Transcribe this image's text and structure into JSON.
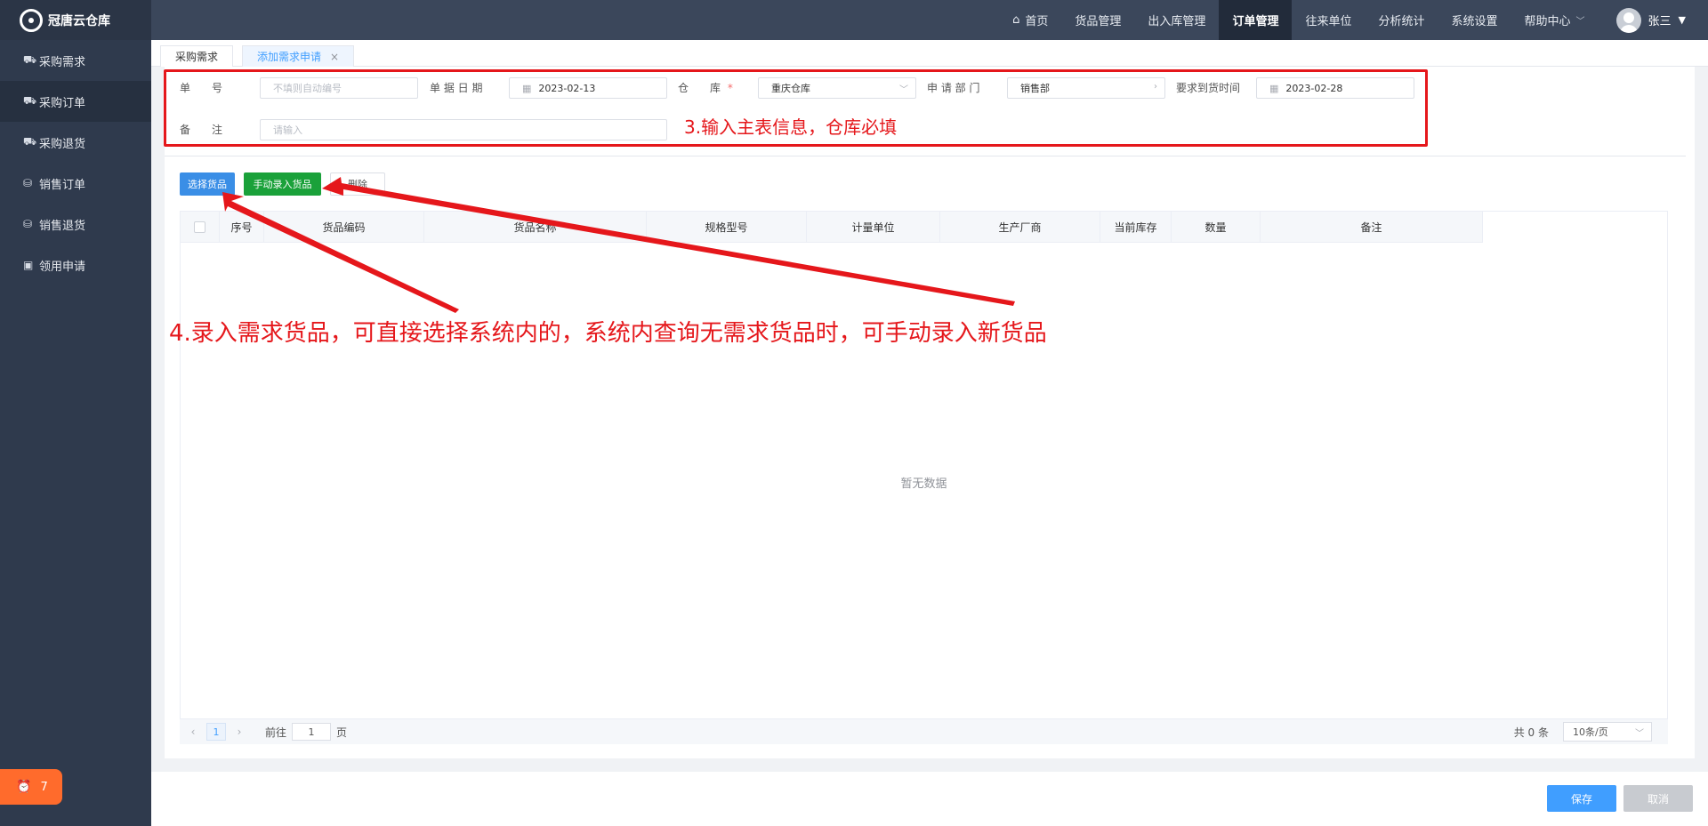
{
  "app": {
    "title": "冠唐云仓库"
  },
  "sidebar": {
    "items": [
      {
        "label": "采购需求",
        "icon": "cart-icon",
        "active": false
      },
      {
        "label": "采购订单",
        "icon": "cart-icon",
        "active": true
      },
      {
        "label": "采购退货",
        "icon": "cart-icon",
        "active": false
      },
      {
        "label": "销售订单",
        "icon": "bag-icon",
        "active": false
      },
      {
        "label": "销售退货",
        "icon": "bag-icon",
        "active": false
      },
      {
        "label": "领用申请",
        "icon": "briefcase-icon",
        "active": false
      }
    ],
    "notification_count": "7"
  },
  "topnav": {
    "items": [
      {
        "label": "首页",
        "icon": "home-icon"
      },
      {
        "label": "货品管理"
      },
      {
        "label": "出入库管理"
      },
      {
        "label": "订单管理",
        "active": true
      },
      {
        "label": "往来单位"
      },
      {
        "label": "分析统计"
      },
      {
        "label": "系统设置"
      },
      {
        "label": "帮助中心",
        "has_caret": true
      }
    ],
    "user": "张三"
  },
  "tabs": [
    {
      "label": "采购需求"
    },
    {
      "label": "添加需求申请",
      "active": true,
      "closable": true
    }
  ],
  "form": {
    "order_no": {
      "label": "单　　号",
      "placeholder": "不填则自动编号"
    },
    "order_date": {
      "label": "单 据 日 期",
      "value": "2023-02-13"
    },
    "warehouse": {
      "label": "仓　　库",
      "required_mark": "*",
      "value": "重庆仓库"
    },
    "department": {
      "label": "申 请 部 门",
      "value": "销售部"
    },
    "due_date": {
      "label": "要求到货时间",
      "value": "2023-02-28"
    },
    "remark": {
      "label": "备　　注",
      "placeholder": "请输入"
    }
  },
  "annotations": {
    "step3": "3.输入主表信息，仓库必填",
    "step4": "4.录入需求货品，可直接选择系统内的，系统内查询无需求货品时，可手动录入新货品"
  },
  "actions": {
    "select_goods": "选择货品",
    "manual_entry": "手动录入货品",
    "delete": "删除"
  },
  "table": {
    "columns": [
      "序号",
      "货品编码",
      "货品名称",
      "规格型号",
      "计量单位",
      "生产厂商",
      "当前库存",
      "数量",
      "备注"
    ],
    "empty_text": "暂无数据"
  },
  "pagination": {
    "current_page": "1",
    "goto_label": "前往",
    "goto_value": "1",
    "page_suffix": "页",
    "total": "共 0 条",
    "page_size": "10条/页"
  },
  "footer": {
    "save": "保存",
    "cancel": "取消"
  },
  "colors": {
    "annotation": "#e5171b",
    "primary": "#409eff",
    "success": "#1aa13a",
    "sidebar": "#2f3a4d",
    "topbar": "#3b475b"
  }
}
